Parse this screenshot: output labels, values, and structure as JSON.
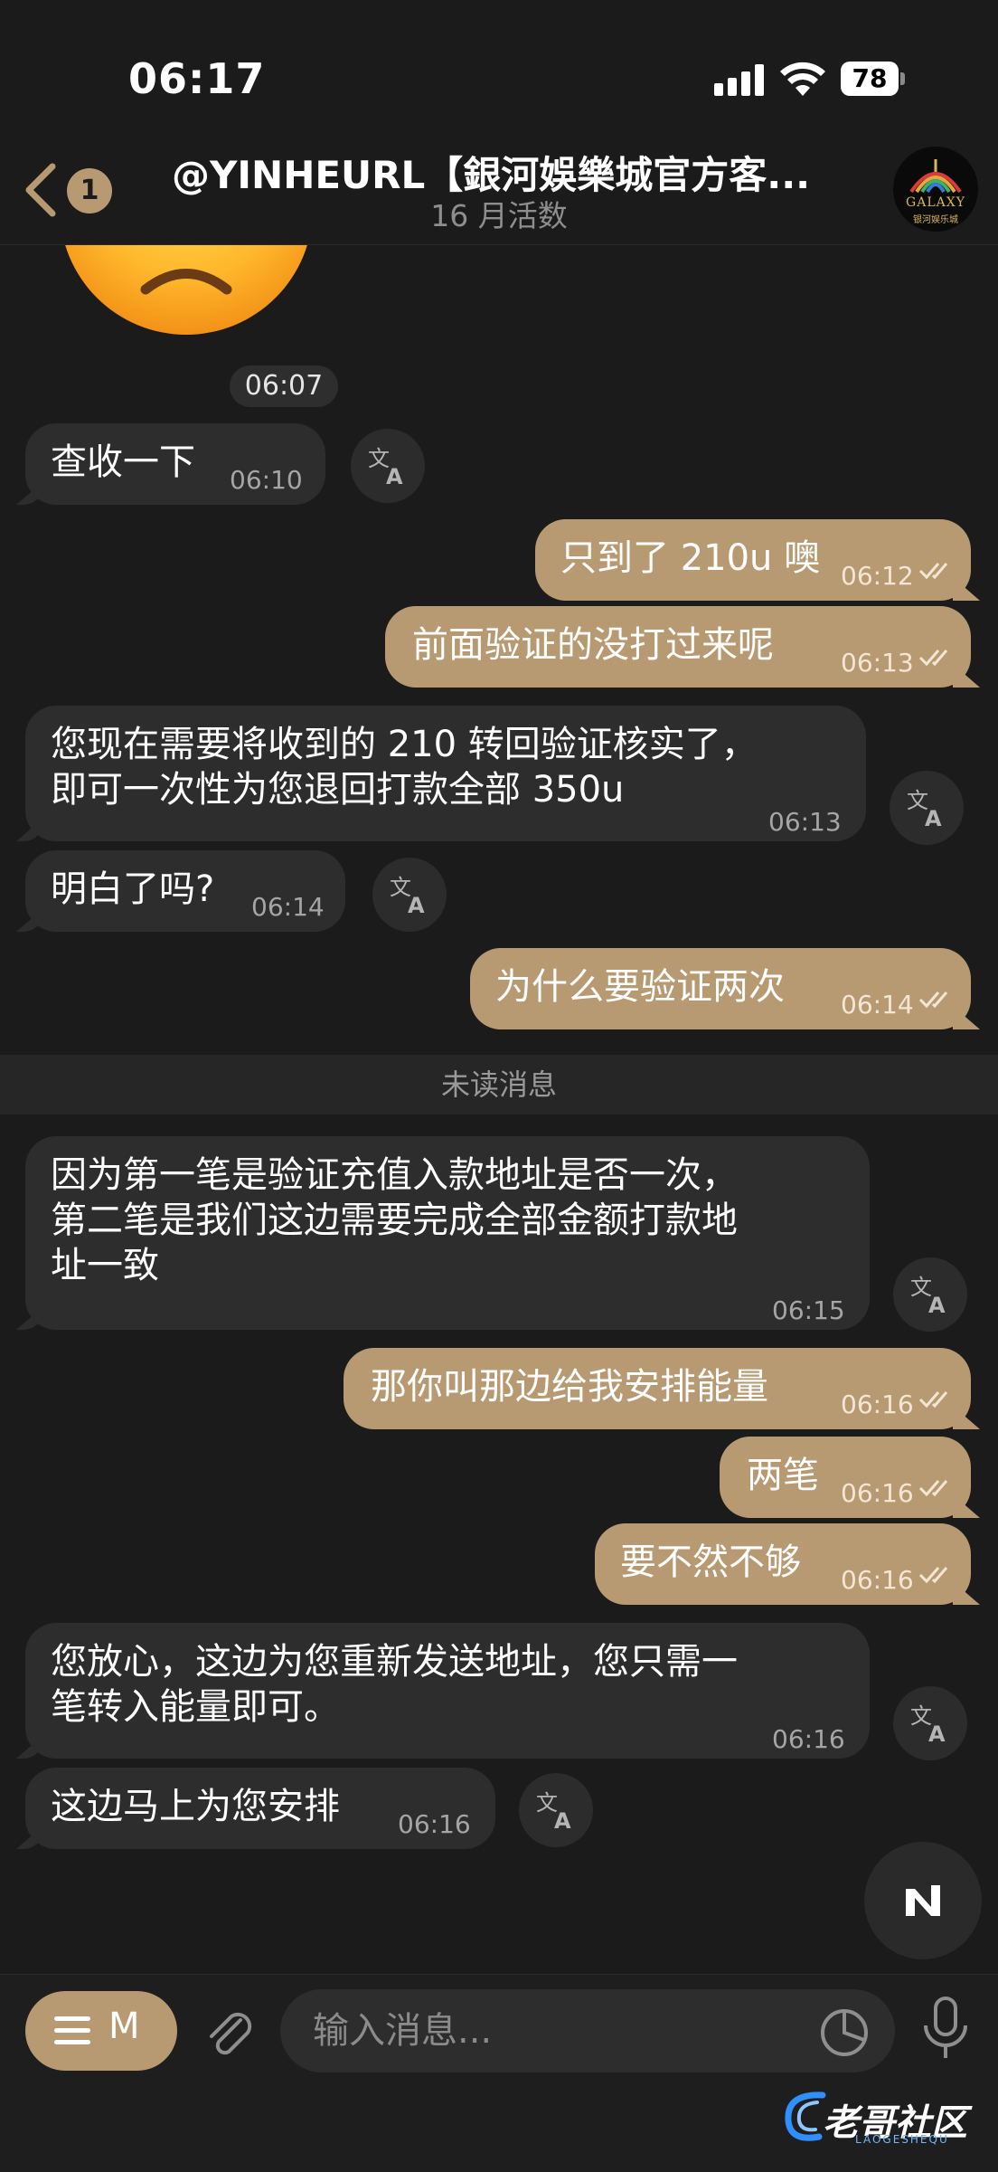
{
  "status_bar": {
    "time": "06:17",
    "battery": "78"
  },
  "header": {
    "back_badge": "1",
    "title": "@YINHEURL【銀河娛樂城官方客...",
    "subtitle": "16 月活数",
    "avatar_text": "GALAXY",
    "avatar_subtext": "银河娱乐城"
  },
  "messages": [
    {
      "id": 0,
      "type": "sticker",
      "emoji": "😞",
      "time": "06:07"
    },
    {
      "id": 1,
      "direction": "in",
      "text": "查收一下",
      "time": "06:10"
    },
    {
      "id": 2,
      "direction": "out",
      "text": "只到了 210u 噢",
      "time": "06:12",
      "read": true
    },
    {
      "id": 3,
      "direction": "out",
      "text": "前面验证的没打过来呢",
      "time": "06:13",
      "read": true
    },
    {
      "id": 4,
      "direction": "in",
      "text": "您现在需要将收到的 210 转回验证核实了，\n即可一次性为您退回打款全部 350u",
      "time": "06:13"
    },
    {
      "id": 5,
      "direction": "in",
      "text": "明白了吗?",
      "time": "06:14"
    },
    {
      "id": 6,
      "direction": "out",
      "text": "为什么要验证两次",
      "time": "06:14",
      "read": true
    },
    {
      "id": 7,
      "direction": "in",
      "text": "因为第一笔是验证充值入款地址是否一次，\n第二笔是我们这边需要完成全部金额打款地\n址一致",
      "time": "06:15"
    },
    {
      "id": 8,
      "direction": "out",
      "text": "那你叫那边给我安排能量",
      "time": "06:16",
      "read": true
    },
    {
      "id": 9,
      "direction": "out",
      "text": "两笔",
      "time": "06:16",
      "read": true
    },
    {
      "id": 10,
      "direction": "out",
      "text": "要不然不够",
      "time": "06:16",
      "read": true
    },
    {
      "id": 11,
      "direction": "in",
      "text": "您放心，这边为您重新发送地址，您只需一\n笔转入能量即可。",
      "time": "06:16"
    },
    {
      "id": 12,
      "direction": "in",
      "text": "这边马上为您安排",
      "time": "06:16"
    }
  ],
  "unread_label": "未读消息",
  "composer": {
    "menu_label": "M",
    "placeholder": "输入消息..."
  },
  "watermark": {
    "text": "老哥社区",
    "sub": "LAOGESHEQU"
  },
  "colors": {
    "background": "#1b1b1b",
    "incoming_bubble": "#2d2d2d",
    "outgoing_bubble": "#b89a72",
    "accent": "#b89a72"
  },
  "icons": [
    "back-chevron-icon",
    "translate-icon",
    "read-ticks-icon",
    "scroll-down-icon",
    "menu-icon",
    "paperclip-icon",
    "sticker-icon",
    "microphone-icon"
  ]
}
